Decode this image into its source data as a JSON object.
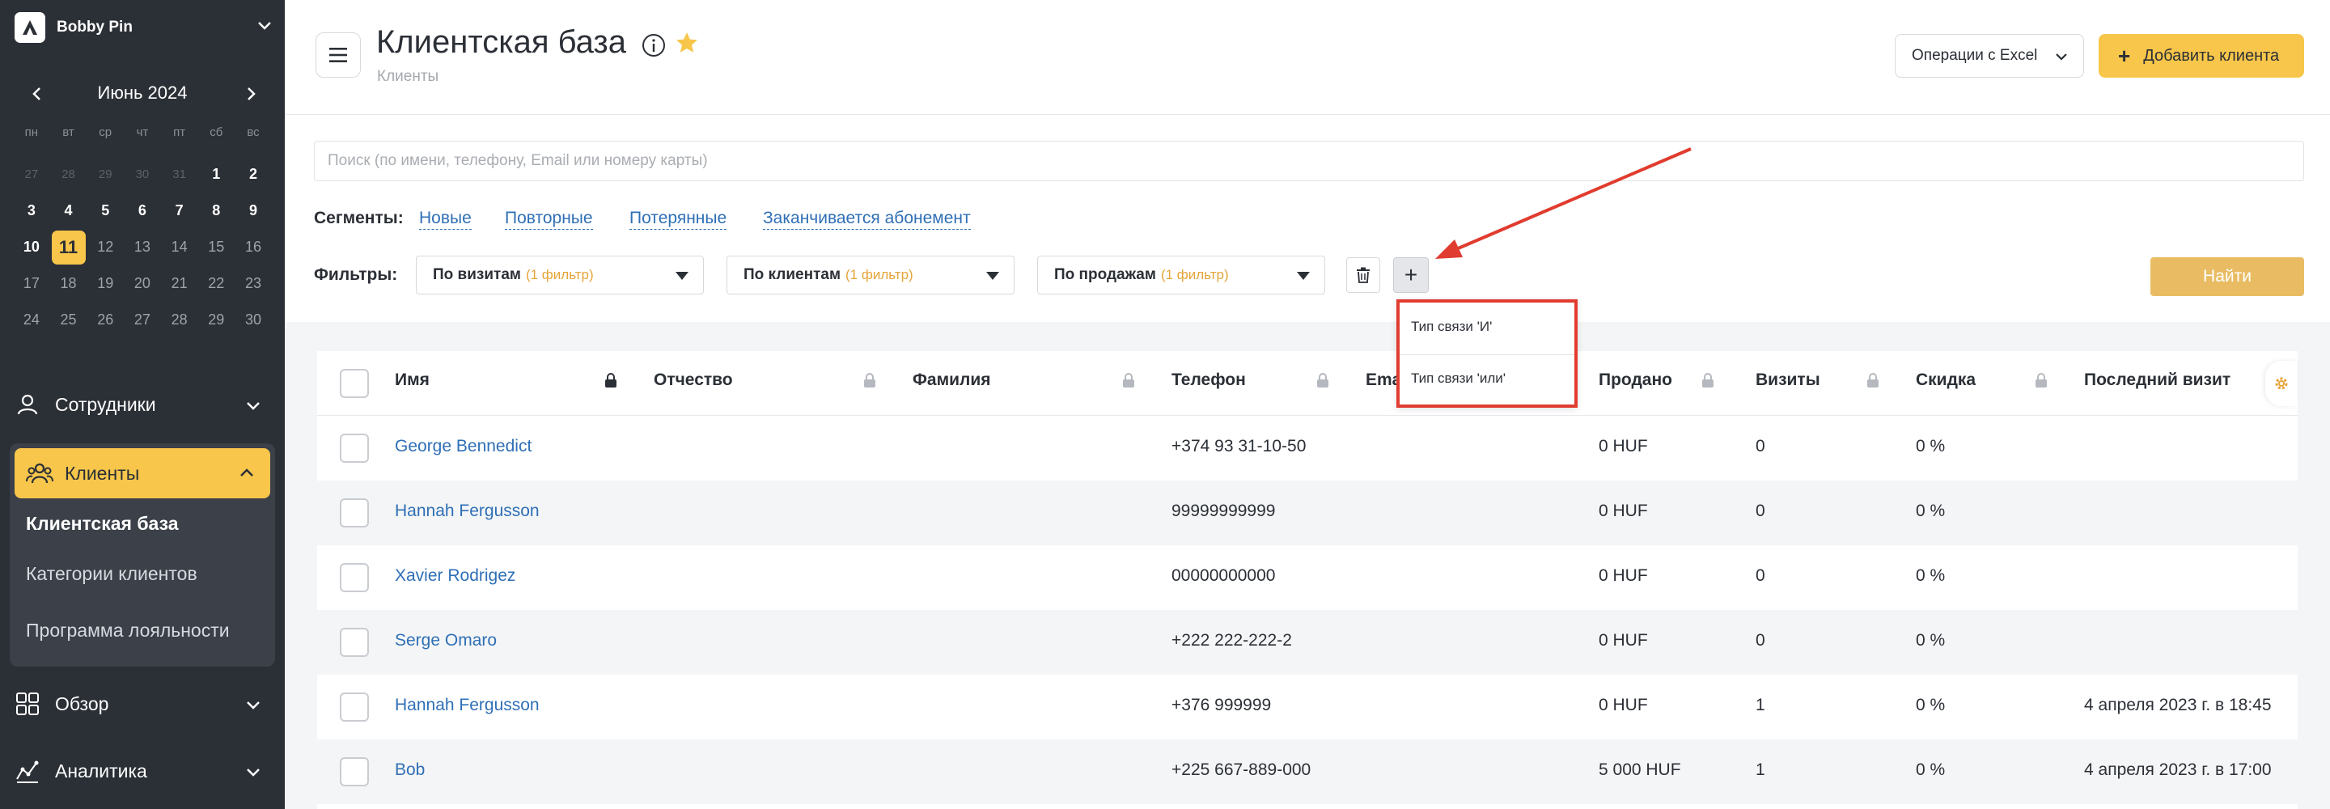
{
  "sidebar": {
    "account_name": "Bobby Pin",
    "calendar": {
      "month_label": "Июнь 2024",
      "weekdays": [
        "пн",
        "вт",
        "ср",
        "чт",
        "пт",
        "сб",
        "вс"
      ],
      "weeks": [
        [
          "27",
          "28",
          "29",
          "30",
          "31",
          "1",
          "2"
        ],
        [
          "3",
          "4",
          "5",
          "6",
          "7",
          "8",
          "9"
        ],
        [
          "10",
          "11",
          "12",
          "13",
          "14",
          "15",
          "16"
        ],
        [
          "17",
          "18",
          "19",
          "20",
          "21",
          "22",
          "23"
        ],
        [
          "24",
          "25",
          "26",
          "27",
          "28",
          "29",
          "30"
        ]
      ],
      "selected_day": "11"
    },
    "nav": {
      "employees": "Сотрудники",
      "clients": "Клиенты",
      "clients_sub": [
        "Клиентская база",
        "Категории клиентов",
        "Программа лояльности"
      ],
      "overview": "Обзор",
      "analytics": "Аналитика"
    }
  },
  "header": {
    "title": "Клиентская база",
    "breadcrumb": "Клиенты",
    "excel_button": "Операции с Excel",
    "add_client_button": "Добавить клиента"
  },
  "search": {
    "placeholder": "Поиск (по имени, телефону, Email или номеру карты)"
  },
  "segments": {
    "label": "Сегменты:",
    "items": [
      "Новые",
      "Повторные",
      "Потерянные",
      "Заканчивается абонемент"
    ]
  },
  "filters": {
    "label": "Фильтры:",
    "selects": [
      {
        "label": "По визитам",
        "count": "(1 фильтр)"
      },
      {
        "label": "По клиентам",
        "count": "(1 фильтр)"
      },
      {
        "label": "По продажам",
        "count": "(1 фильтр)"
      }
    ],
    "find_button": "Найти",
    "add_symbol": "+"
  },
  "dropdown": {
    "items": [
      "Тип связи 'И'",
      "Тип связи 'или'"
    ]
  },
  "table": {
    "columns": [
      "Имя",
      "Отчество",
      "Фамилия",
      "Телефон",
      "Ema",
      "Продано",
      "Визиты",
      "Скидка",
      "Последний визит"
    ],
    "rows": [
      {
        "name": "George Bennedict",
        "phone": "+374 93 31-10-50",
        "sold": "0 HUF",
        "visits": "0",
        "discount": "0 %",
        "last_visit": ""
      },
      {
        "name": "Hannah Fergusson",
        "phone": "99999999999",
        "sold": "0 HUF",
        "visits": "0",
        "discount": "0 %",
        "last_visit": ""
      },
      {
        "name": "Xavier Rodrigez",
        "phone": "00000000000",
        "sold": "0 HUF",
        "visits": "0",
        "discount": "0 %",
        "last_visit": ""
      },
      {
        "name": "Serge Omaro",
        "phone": "+222 222-222-2",
        "sold": "0 HUF",
        "visits": "0",
        "discount": "0 %",
        "last_visit": ""
      },
      {
        "name": "Hannah Fergusson",
        "phone": "+376 999999",
        "sold": "0 HUF",
        "visits": "1",
        "discount": "0 %",
        "last_visit": "4 апреля 2023 г. в 18:45"
      },
      {
        "name": "Bob",
        "phone": "+225 667-889-000",
        "sold": "5 000 HUF",
        "visits": "1",
        "discount": "0 %",
        "last_visit": "4 апреля 2023 г. в 17:00"
      }
    ]
  },
  "colors": {
    "sidebar_bg": "#2b2f36",
    "accent_yellow": "#f7c64a",
    "link_blue": "#2f6fb6",
    "annotation_red": "#e03c2f",
    "filter_count_orange": "#e6a43a"
  }
}
